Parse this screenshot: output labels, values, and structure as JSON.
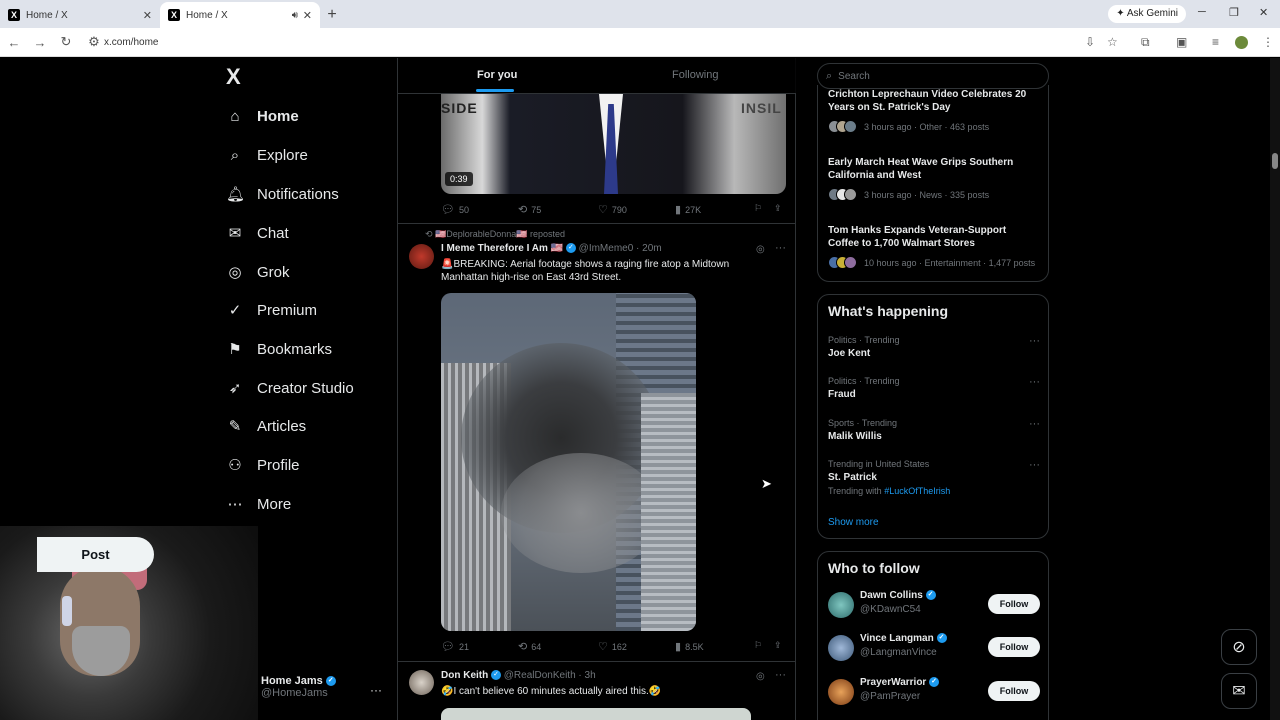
{
  "browser": {
    "tabs": [
      {
        "title": "Home / X"
      },
      {
        "title": "Home / X"
      }
    ],
    "new_tab": "+",
    "gemini": "Ask Gemini",
    "url": "x.com/home"
  },
  "nav": {
    "logo": "X",
    "items": [
      {
        "label": "Home",
        "icon": "home-icon",
        "glyph": "⌂"
      },
      {
        "label": "Explore",
        "icon": "search-icon",
        "glyph": "⌕"
      },
      {
        "label": "Notifications",
        "icon": "bell-icon",
        "glyph": "🔔︎"
      },
      {
        "label": "Chat",
        "icon": "mail-icon",
        "glyph": "✉"
      },
      {
        "label": "Grok",
        "icon": "grok-icon",
        "glyph": "◎"
      },
      {
        "label": "Premium",
        "icon": "premium-icon",
        "glyph": "✓"
      },
      {
        "label": "Bookmarks",
        "icon": "bookmark-icon",
        "glyph": "⚑"
      },
      {
        "label": "Creator Studio",
        "icon": "rocket-icon",
        "glyph": "➶"
      },
      {
        "label": "Articles",
        "icon": "articles-icon",
        "glyph": "✎"
      },
      {
        "label": "Profile",
        "icon": "person-icon",
        "glyph": "⚇"
      },
      {
        "label": "More",
        "icon": "more-circle-icon",
        "glyph": "⋯"
      }
    ],
    "post_label": "Post",
    "account_name": "Home Jams",
    "account_handle": "@HomeJams",
    "account_more": "···"
  },
  "feed": {
    "tabs": {
      "for_you": "For you",
      "following": "Following"
    },
    "video_overlay_left": "SIDE",
    "video_overlay_right": "INSIL",
    "video_duration": "0:39",
    "tweet0_actions": {
      "replies": "50",
      "reposts": "75",
      "likes": "790",
      "views": "27K"
    },
    "tweet1": {
      "reposted_by": "🇺🇸DeplorableDonna🇺🇸 reposted",
      "name": "I Meme Therefore I Am 🇺🇸",
      "handle": "@ImMeme0 · 20m",
      "text": "🚨BREAKING: Aerial footage shows a raging fire atop a Midtown Manhattan high-rise on East 43rd Street.",
      "replies": "21",
      "reposts": "64",
      "likes": "162",
      "views": "8.5K"
    },
    "tweet2": {
      "name": "Don Keith",
      "handle": "@RealDonKeith · 3h",
      "text": "🤣I can't believe 60 minutes actually aired this.🤣"
    }
  },
  "right": {
    "search_placeholder": "Search",
    "news": [
      {
        "title": "Crichton Leprechaun Video Celebrates 20 Years on St. Patrick's Day",
        "meta": "3 hours ago · Other · 463 posts"
      },
      {
        "title": "Early March Heat Wave Grips Southern California and West",
        "meta": "3 hours ago · News · 335 posts"
      },
      {
        "title": "Tom Hanks Expands Veteran-Support Coffee to 1,700 Walmart Stores",
        "meta": "10 hours ago · Entertainment · 1,477 posts"
      }
    ],
    "happening_title": "What's happening",
    "trends": [
      {
        "context": "Politics · Trending",
        "name": "Joe Kent"
      },
      {
        "context": "Politics · Trending",
        "name": "Fraud"
      },
      {
        "context": "Sports · Trending",
        "name": "Malik Willis"
      },
      {
        "context": "Trending in United States",
        "name": "St. Patrick",
        "with_label": "Trending with",
        "with_tag": "#LuckOfTheIrish"
      }
    ],
    "show_more": "Show more",
    "wtf_title": "Who to follow",
    "follow": [
      {
        "name": "Dawn Collins",
        "handle": "@KDawnC54",
        "button": "Follow"
      },
      {
        "name": "Vince Langman",
        "handle": "@LangmanVince",
        "button": "Follow"
      },
      {
        "name": "PrayerWarrior",
        "handle": "@PamPrayer",
        "button": "Follow"
      }
    ]
  },
  "colors": {
    "accent": "#1d9bf0",
    "background": "#000000",
    "text": "#e7e9ea",
    "muted": "#71767b",
    "border": "#2f3336"
  }
}
